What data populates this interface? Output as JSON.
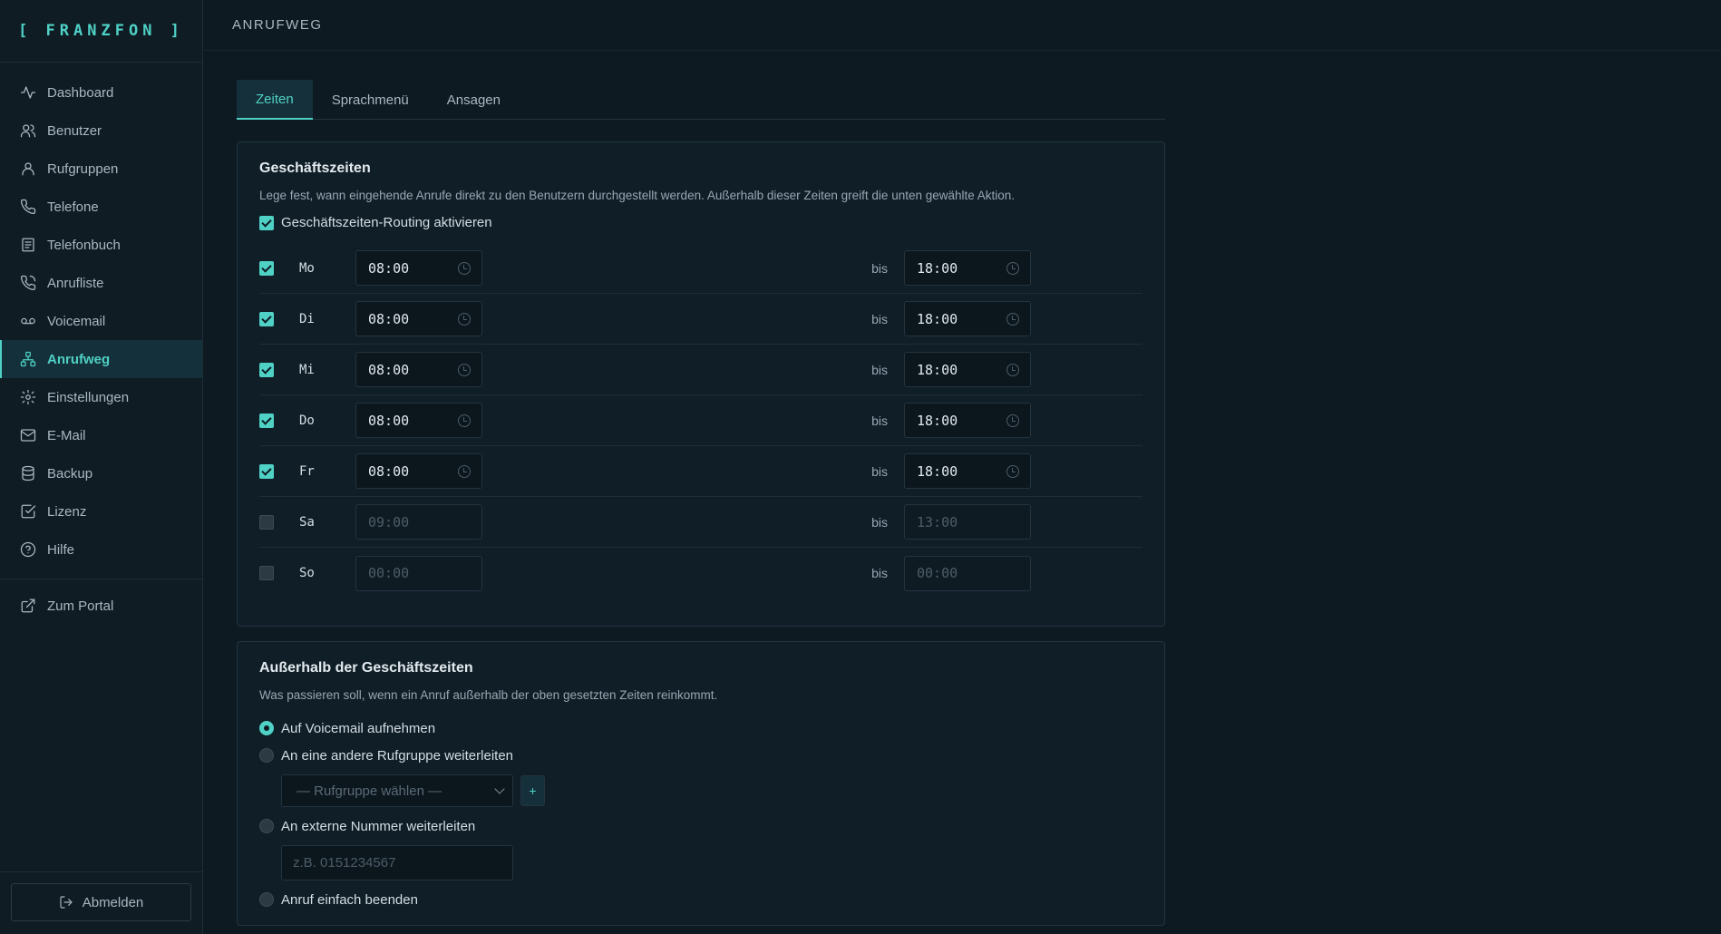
{
  "brand": "[ FRANZFON ]",
  "page_title": "ANRUFWEG",
  "nav": [
    {
      "label": "Dashboard",
      "icon": "activity-icon"
    },
    {
      "label": "Benutzer",
      "icon": "users-icon"
    },
    {
      "label": "Rufgruppen",
      "icon": "user-group-icon"
    },
    {
      "label": "Telefone",
      "icon": "phone-icon"
    },
    {
      "label": "Telefonbuch",
      "icon": "book-icon"
    },
    {
      "label": "Anrufliste",
      "icon": "phone-call-icon"
    },
    {
      "label": "Voicemail",
      "icon": "voicemail-icon"
    },
    {
      "label": "Anrufweg",
      "icon": "network-icon",
      "active": true
    },
    {
      "label": "Einstellungen",
      "icon": "gear-icon"
    },
    {
      "label": "E-Mail",
      "icon": "mail-icon"
    },
    {
      "label": "Backup",
      "icon": "database-icon"
    },
    {
      "label": "Lizenz",
      "icon": "check-square-icon"
    },
    {
      "label": "Hilfe",
      "icon": "help-circle-icon"
    }
  ],
  "portal_label": "Zum Portal",
  "logout_label": "Abmelden",
  "tabs": [
    {
      "label": "Zeiten",
      "active": true
    },
    {
      "label": "Sprachmenü"
    },
    {
      "label": "Ansagen"
    }
  ],
  "business_hours": {
    "title": "Geschäftszeiten",
    "description": "Lege fest, wann eingehende Anrufe direkt zu den Benutzern durchgestellt werden. Außerhalb dieser Zeiten greift die unten gewählte Aktion.",
    "enable_label": "Geschäftszeiten-Routing aktivieren",
    "enabled": true,
    "separator": "bis",
    "days": [
      {
        "label": "Mo",
        "enabled": true,
        "from": "08:00",
        "to": "18:00"
      },
      {
        "label": "Di",
        "enabled": true,
        "from": "08:00",
        "to": "18:00"
      },
      {
        "label": "Mi",
        "enabled": true,
        "from": "08:00",
        "to": "18:00"
      },
      {
        "label": "Do",
        "enabled": true,
        "from": "08:00",
        "to": "18:00"
      },
      {
        "label": "Fr",
        "enabled": true,
        "from": "08:00",
        "to": "18:00"
      },
      {
        "label": "Sa",
        "enabled": false,
        "from": "09:00",
        "to": "13:00"
      },
      {
        "label": "So",
        "enabled": false,
        "from": "00:00",
        "to": "00:00"
      }
    ]
  },
  "after_hours": {
    "title": "Außerhalb der Geschäftszeiten",
    "description": "Was passieren soll, wenn ein Anruf außerhalb der oben gesetzten Zeiten reinkommt.",
    "options": [
      {
        "label": "Auf Voicemail aufnehmen",
        "selected": true
      },
      {
        "label": "An eine andere Rufgruppe weiterleiten",
        "selected": false
      },
      {
        "label": "An externe Nummer weiterleiten",
        "selected": false
      },
      {
        "label": "Anruf einfach beenden",
        "selected": false
      }
    ],
    "group_select_placeholder": "— Rufgruppe wählen —",
    "add_button": "+",
    "external_number_placeholder": "z.B. 0151234567"
  },
  "colors": {
    "accent": "#4fd1c5",
    "background": "#0d1a22",
    "card": "#0f1e27"
  }
}
